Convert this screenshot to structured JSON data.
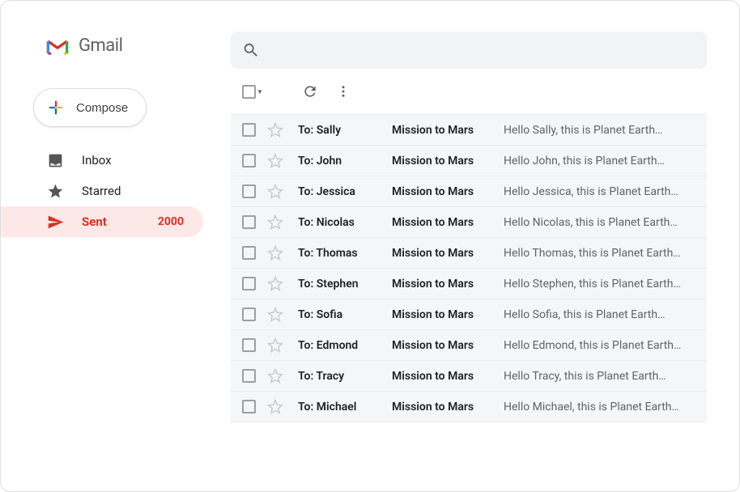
{
  "app": {
    "name": "Gmail"
  },
  "compose": {
    "label": "Compose"
  },
  "nav": {
    "items": [
      {
        "label": "Inbox",
        "count": ""
      },
      {
        "label": "Starred",
        "count": ""
      },
      {
        "label": "Sent",
        "count": "2000"
      }
    ]
  },
  "mail": {
    "rows": [
      {
        "to": "To: Sally",
        "subject": "Mission to Mars",
        "snippet": "Hello Sally, this is Planet Earth…"
      },
      {
        "to": "To: John",
        "subject": "Mission to Mars",
        "snippet": "Hello John, this is Planet Earth…"
      },
      {
        "to": "To: Jessica",
        "subject": "Mission to Mars",
        "snippet": "Hello Jessica, this is Planet Earth…"
      },
      {
        "to": "To: Nicolas",
        "subject": "Mission to Mars",
        "snippet": "Hello Nicolas, this is Planet Earth…"
      },
      {
        "to": "To: Thomas",
        "subject": "Mission to Mars",
        "snippet": "Hello Thomas, this is Planet Earth…"
      },
      {
        "to": "To: Stephen",
        "subject": "Mission to Mars",
        "snippet": "Hello Stephen, this is Planet Earth…"
      },
      {
        "to": "To: Sofia",
        "subject": "Mission to Mars",
        "snippet": "Hello Sofia, this is Planet Earth…"
      },
      {
        "to": "To: Edmond",
        "subject": "Mission to Mars",
        "snippet": "Hello Edmond, this is Planet Earth…"
      },
      {
        "to": "To: Tracy",
        "subject": "Mission to Mars",
        "snippet": "Hello Tracy, this is Planet Earth…"
      },
      {
        "to": "To: Michael",
        "subject": "Mission to Mars",
        "snippet": "Hello Michael, this is Planet Earth…"
      }
    ]
  }
}
